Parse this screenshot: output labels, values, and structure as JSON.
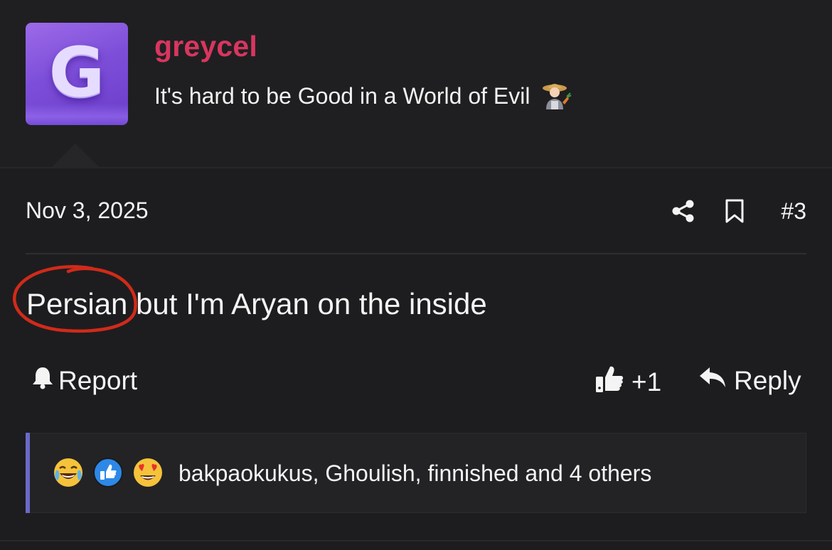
{
  "author": {
    "avatar_letter": "G",
    "username": "greycel",
    "user_title": "It's hard to be Good in a World of Evil",
    "title_emoji": "farmer-emoji"
  },
  "post": {
    "date": "Nov 3, 2025",
    "number": "#3",
    "message": "Persian but I'm Aryan on the inside",
    "annotation": "red hand-drawn circle around 'Persian'"
  },
  "actions": {
    "report_label": "Report",
    "like_count": "+1",
    "reply_label": "Reply"
  },
  "reactions": {
    "icons": [
      "crying-laughing-emoji",
      "like-emoji",
      "heart-eyes-emoji"
    ],
    "summary": "bakpaokukus, Ghoulish, finnished and 4 others"
  },
  "colors": {
    "background": "#1d1d1f",
    "username": "#d8365f",
    "avatar": "#7d4fd9",
    "reactions_accent": "#6b69c9",
    "annotation": "#d12a1a"
  }
}
